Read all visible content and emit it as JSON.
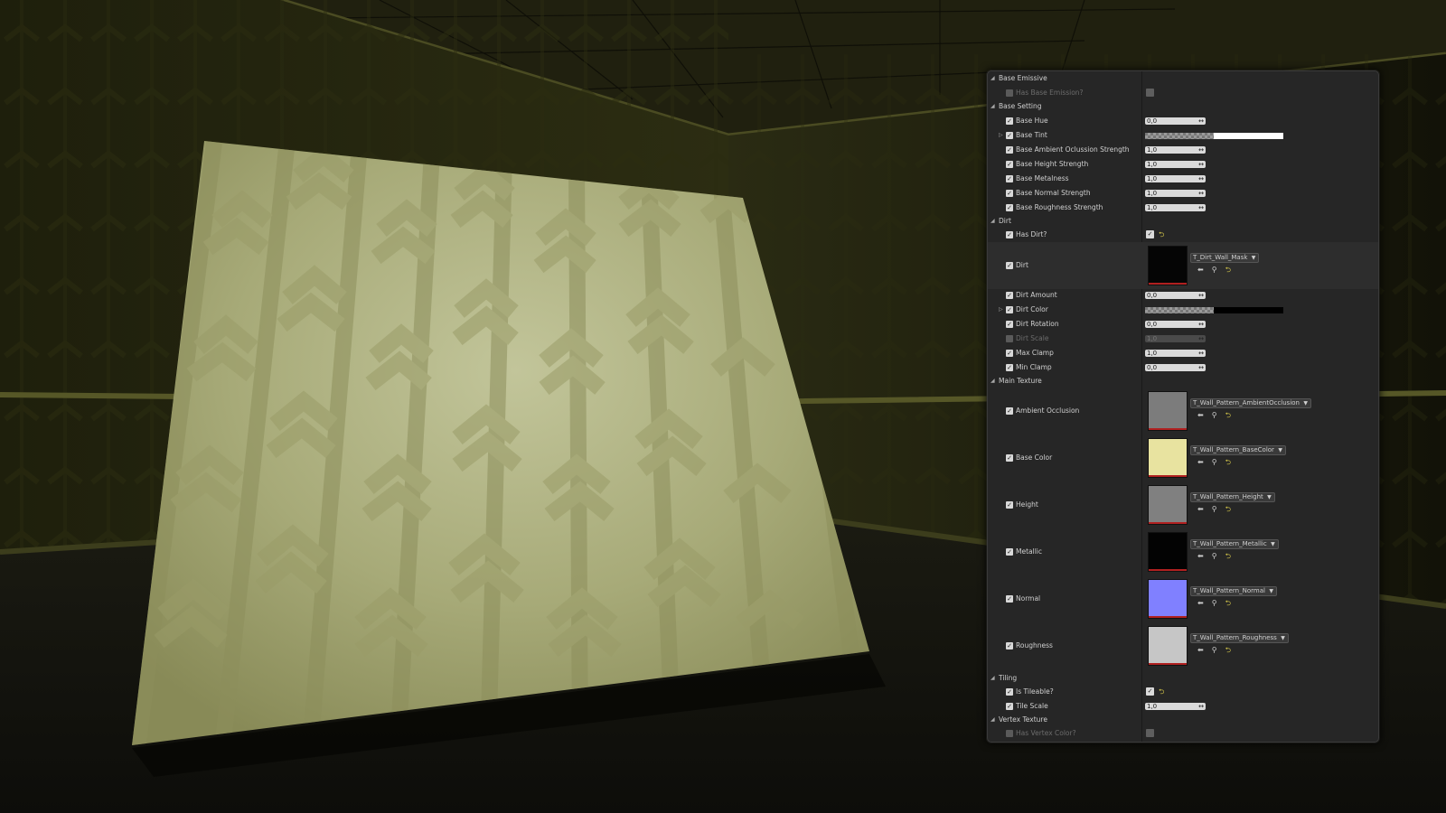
{
  "panel": {
    "categories": {
      "base_emissive": "Base Emissive",
      "base_setting": "Base Setting",
      "dirt": "Dirt",
      "main_texture": "Main Texture",
      "tiling": "Tiling",
      "vertex_texture": "Vertex Texture"
    },
    "props": {
      "has_base_emission": {
        "label": "Has Base Emission?",
        "enabled": false,
        "value": false
      },
      "base_hue": {
        "label": "Base Hue",
        "value": "0,0"
      },
      "base_tint": {
        "label": "Base Tint",
        "color": "#ffffff"
      },
      "base_ao_strength": {
        "label": "Base Ambient Oclussion Strength",
        "value": "1,0"
      },
      "base_height_strength": {
        "label": "Base Height Strength",
        "value": "1,0"
      },
      "base_metalness": {
        "label": "Base Metalness",
        "value": "1,0"
      },
      "base_normal_strength": {
        "label": "Base Normal Strength",
        "value": "1,0"
      },
      "base_roughness_strength": {
        "label": "Base Roughness Strength",
        "value": "1,0"
      },
      "has_dirt": {
        "label": "Has Dirt?",
        "value": true
      },
      "dirt": {
        "label": "Dirt",
        "asset": "T_Dirt_Wall_Mask"
      },
      "dirt_amount": {
        "label": "Dirt Amount",
        "value": "0,0"
      },
      "dirt_color": {
        "label": "Dirt Color",
        "color": "#000000"
      },
      "dirt_rotation": {
        "label": "Dirt Rotation",
        "value": "0,0"
      },
      "dirt_scale": {
        "label": "Dirt Scale",
        "value": "1,0",
        "enabled": false
      },
      "max_clamp": {
        "label": "Max Clamp",
        "value": "1,0"
      },
      "min_clamp": {
        "label": "Min Clamp",
        "value": "0,0"
      },
      "ambient_occlusion": {
        "label": "Ambient Occlusion",
        "asset": "T_Wall_Pattern_AmbientOcclusion"
      },
      "base_color": {
        "label": "Base Color",
        "asset": "T_Wall_Pattern_BaseColor"
      },
      "height": {
        "label": "Height",
        "asset": "T_Wall_Pattern_Height"
      },
      "metallic": {
        "label": "Metallic",
        "asset": "T_Wall_Pattern_Metallic"
      },
      "normal": {
        "label": "Normal",
        "asset": "T_Wall_Pattern_Normal"
      },
      "roughness": {
        "label": "Roughness",
        "asset": "T_Wall_Pattern_Roughness"
      },
      "is_tileable": {
        "label": "Is Tileable?",
        "value": true
      },
      "tile_scale": {
        "label": "Tile Scale",
        "value": "1,0"
      },
      "has_vertex_color": {
        "label": "Has Vertex Color?",
        "enabled": false,
        "value": false
      }
    },
    "thumb_colors": {
      "dirt": "#050505",
      "ambient_occlusion": "#7c7c7c",
      "base_color": "#e8e3a0",
      "height": "#808080",
      "metallic": "#030303",
      "normal": "#8080ff",
      "roughness": "#c6c6c6"
    }
  },
  "icons": {
    "check": "check-icon",
    "drag": "drag-arrows-icon",
    "reset": "reset-arrow-icon",
    "browse": "browse-arrow-icon",
    "search": "magnifier-icon",
    "expand": "triangle-icon"
  }
}
